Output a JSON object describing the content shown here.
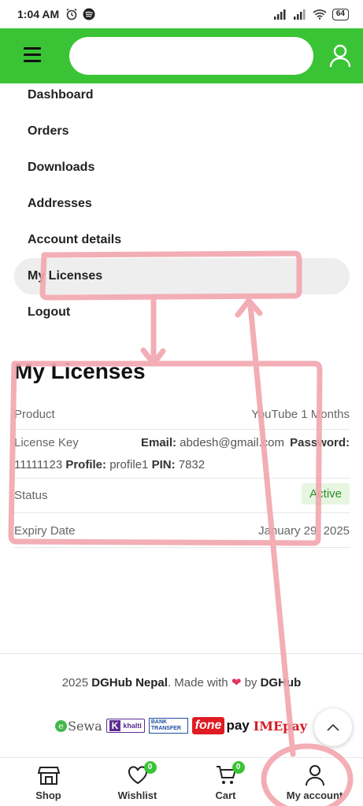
{
  "status_bar": {
    "time": "1:04 AM",
    "battery": "64"
  },
  "header": {
    "search_placeholder": ""
  },
  "account_nav": {
    "items": [
      {
        "label": "Dashboard",
        "active": false
      },
      {
        "label": "Orders",
        "active": false
      },
      {
        "label": "Downloads",
        "active": false
      },
      {
        "label": "Addresses",
        "active": false
      },
      {
        "label": "Account details",
        "active": false
      },
      {
        "label": "My Licenses",
        "active": true
      },
      {
        "label": "Logout",
        "active": false
      }
    ]
  },
  "page_title": "My Licenses",
  "license": {
    "product_label": "Product",
    "product_value": "YouTube 1 Months",
    "key_label": "License Key",
    "email_label": "Email:",
    "email_value": "abdesh@gmail.com",
    "password_label": "Password:",
    "password_value": "11111123",
    "profile_label": "Profile:",
    "profile_value": "profile1",
    "pin_label": "PIN:",
    "pin_value": "7832",
    "status_label": "Status",
    "status_value": "Active",
    "expiry_label": "Expiry Date",
    "expiry_value": "January 29, 2025"
  },
  "footer": {
    "year": "2025",
    "brand": "DGHub Nepal",
    "made_with": ". Made with",
    "by": "by",
    "author": "DGHub",
    "payments": {
      "esewa": "Sewa",
      "khalti": "khalti",
      "bank": "BANK TRANSFER",
      "fone": "fone",
      "pay": "pay",
      "imepay": "IMEpay"
    }
  },
  "bottom_nav": {
    "items": [
      {
        "label": "Shop",
        "icon": "shop-icon"
      },
      {
        "label": "Wishlist",
        "icon": "heart-icon",
        "badge": "0"
      },
      {
        "label": "Cart",
        "icon": "cart-icon",
        "badge": "0"
      },
      {
        "label": "My account",
        "icon": "user-icon"
      }
    ]
  },
  "colors": {
    "brand_green": "#3ac435",
    "annotation_pink": "#f2a5ae",
    "active_bg": "#e6f6e0"
  }
}
